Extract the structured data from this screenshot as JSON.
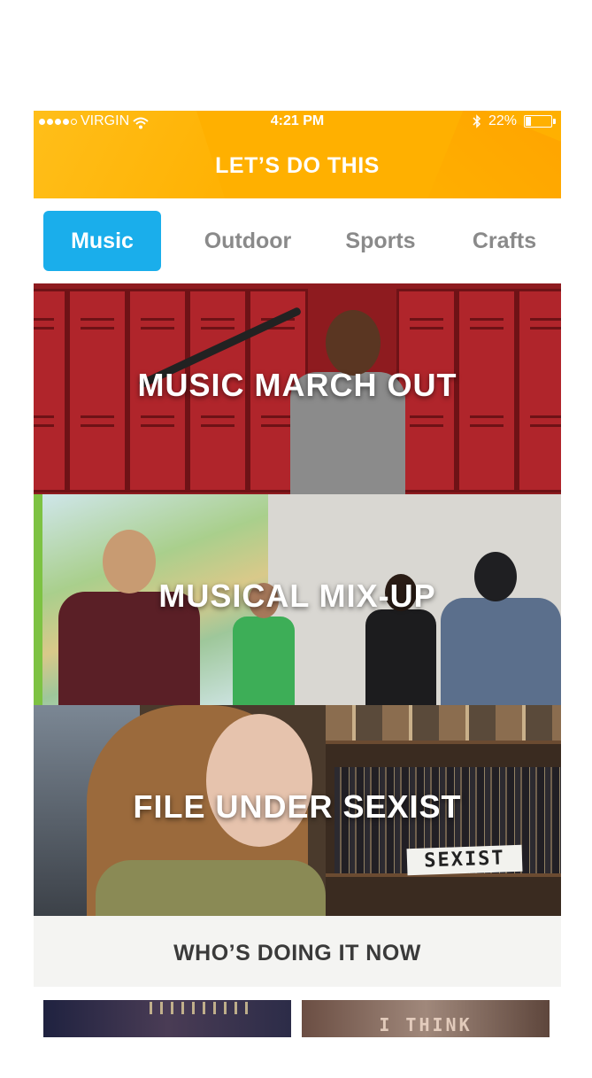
{
  "status_bar": {
    "carrier": "VIRGIN",
    "time": "4:21 PM",
    "battery": "22%",
    "battery_level": 0.22,
    "icons": [
      "signal-dots-icon",
      "wifi-icon",
      "bluetooth-icon",
      "battery-icon"
    ]
  },
  "header": {
    "title": "LET’S DO THIS",
    "color": "#FFB000"
  },
  "tabs": [
    {
      "label": "Music",
      "active": true
    },
    {
      "label": "Outdoor",
      "active": false
    },
    {
      "label": "Sports",
      "active": false
    },
    {
      "label": "Crafts",
      "active": false
    }
  ],
  "accent_color": "#1AAEEB",
  "cards": [
    {
      "title": "MUSIC MARCH OUT"
    },
    {
      "title": "MUSICAL MIX-UP"
    },
    {
      "title": "FILE UNDER SEXIST",
      "sign_text": "SEXIST"
    }
  ],
  "who_section": {
    "title": "WHO’S DOING IT NOW",
    "thumb_text": "I THINK"
  }
}
